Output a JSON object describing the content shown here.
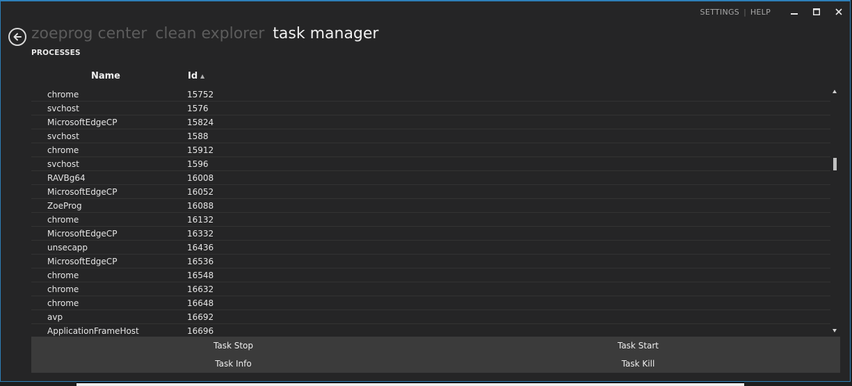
{
  "topbar": {
    "settings": "SETTINGS",
    "sep": "|",
    "help": "HELP"
  },
  "breadcrumbs": [
    "zoeprog center",
    "clean explorer",
    "task manager"
  ],
  "section_title": "PROCESSES",
  "columns": {
    "name": "Name",
    "id": "Id"
  },
  "sort": {
    "column": "Id",
    "direction": "ascending"
  },
  "scroll": {
    "position_fraction": 0.28
  },
  "processes": [
    {
      "name": "chrome",
      "id": "15752"
    },
    {
      "name": "svchost",
      "id": "1576"
    },
    {
      "name": "MicrosoftEdgeCP",
      "id": "15824"
    },
    {
      "name": "svchost",
      "id": "1588"
    },
    {
      "name": "chrome",
      "id": "15912"
    },
    {
      "name": "svchost",
      "id": "1596"
    },
    {
      "name": "RAVBg64",
      "id": "16008"
    },
    {
      "name": "MicrosoftEdgeCP",
      "id": "16052"
    },
    {
      "name": "ZoeProg",
      "id": "16088"
    },
    {
      "name": "chrome",
      "id": "16132"
    },
    {
      "name": "MicrosoftEdgeCP",
      "id": "16332"
    },
    {
      "name": "unsecapp",
      "id": "16436"
    },
    {
      "name": "MicrosoftEdgeCP",
      "id": "16536"
    },
    {
      "name": "chrome",
      "id": "16548"
    },
    {
      "name": "chrome",
      "id": "16632"
    },
    {
      "name": "chrome",
      "id": "16648"
    },
    {
      "name": "avp",
      "id": "16692"
    },
    {
      "name": "ApplicationFrameHost",
      "id": "16696"
    }
  ],
  "actions": {
    "task_stop": "Task Stop",
    "task_start": "Task Start",
    "task_info": "Task Info",
    "task_kill": "Task Kill"
  },
  "colors": {
    "window_border": "#2d7fb8",
    "background": "#252526",
    "action_bar": "#3b3b3b"
  }
}
